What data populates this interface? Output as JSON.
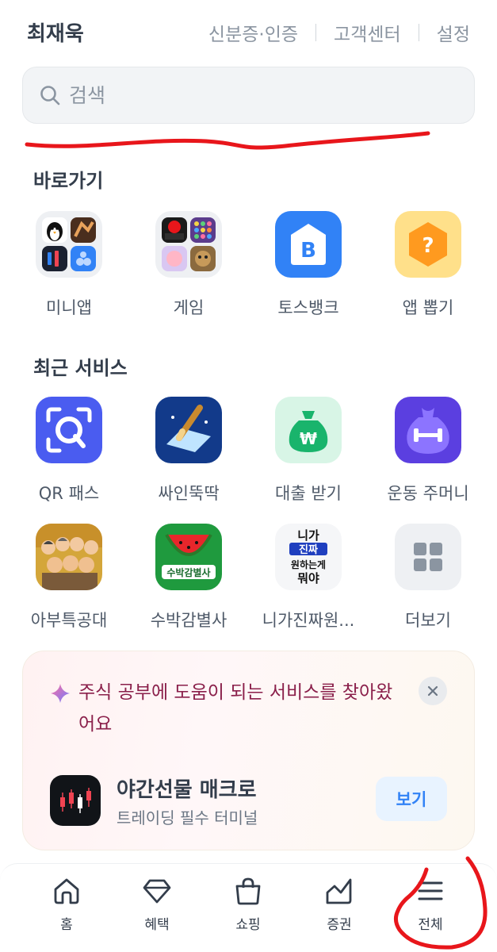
{
  "header": {
    "user_name": "최재욱",
    "links": [
      "신분증·인증",
      "고객센터",
      "설정"
    ]
  },
  "search": {
    "placeholder": "검색"
  },
  "shortcuts": {
    "title": "바로가기",
    "items": [
      {
        "label": "미니앱",
        "icon": "mini-app-icon"
      },
      {
        "label": "게임",
        "icon": "game-icon"
      },
      {
        "label": "토스뱅크",
        "icon": "toss-bank-icon"
      },
      {
        "label": "앱 뽑기",
        "icon": "app-draw-icon"
      }
    ]
  },
  "recent": {
    "title": "최근 서비스",
    "row1": [
      {
        "label": "QR 패스",
        "icon": "qr-pass-icon"
      },
      {
        "label": "싸인뚝딱",
        "icon": "sign-pen-icon"
      },
      {
        "label": "대출 받기",
        "icon": "loan-bag-icon"
      },
      {
        "label": "운동 주머니",
        "icon": "workout-pouch-icon"
      }
    ],
    "row2": [
      {
        "label": "아부특공대",
        "icon": "abu-squad-icon"
      },
      {
        "label": "수박감별사",
        "icon": "watermelon-icon",
        "icon_text": "수박감별사"
      },
      {
        "label": "니가진짜원...",
        "icon": "niga-jinjja-icon",
        "icon_text": [
          "니가",
          "진짜",
          "원하는게",
          "뭐야"
        ]
      },
      {
        "label": "더보기",
        "icon": "more-grid-icon"
      }
    ]
  },
  "promo": {
    "title": "주식 공부에 도움이 되는 서비스를 찾아왔어요",
    "app_name": "야간선물 매크로",
    "app_sub": "트레이딩 필수 터미널",
    "button": "보기"
  },
  "nav": {
    "items": [
      {
        "label": "홈",
        "icon": "home-icon"
      },
      {
        "label": "혜택",
        "icon": "benefit-diamond-icon"
      },
      {
        "label": "쇼핑",
        "icon": "shopping-bag-icon"
      },
      {
        "label": "증권",
        "icon": "stock-chart-icon"
      },
      {
        "label": "전체",
        "icon": "menu-icon"
      }
    ]
  },
  "colors": {
    "accent": "#3182f6",
    "annotation_red": "#e8161b",
    "promo_title": "#8a1f4a"
  }
}
